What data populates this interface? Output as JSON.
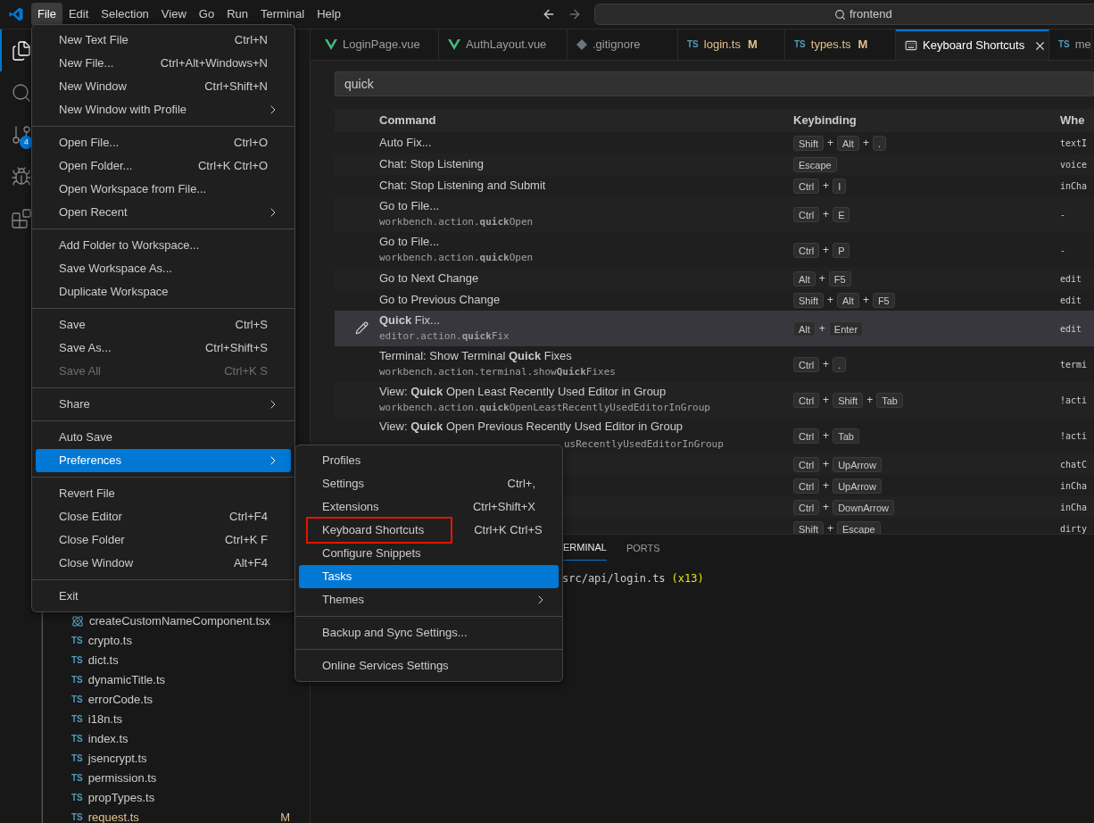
{
  "menu_bar": {
    "items": [
      {
        "label": "File",
        "selected": true
      },
      {
        "label": "Edit",
        "selected": false
      },
      {
        "label": "Selection",
        "selected": false
      },
      {
        "label": "View",
        "selected": false
      },
      {
        "label": "Go",
        "selected": false
      },
      {
        "label": "Run",
        "selected": false
      },
      {
        "label": "Terminal",
        "selected": false
      },
      {
        "label": "Help",
        "selected": false
      }
    ]
  },
  "command_center": {
    "value": "frontend"
  },
  "activity_bar": [
    {
      "kind": "explorer",
      "selected": true
    },
    {
      "kind": "search",
      "selected": false
    },
    {
      "kind": "scm",
      "selected": false,
      "badge": "4"
    },
    {
      "kind": "debug",
      "selected": false
    },
    {
      "kind": "extensions",
      "selected": false
    }
  ],
  "sidebar": {
    "files": [
      {
        "name": "createCustomNameComponent.tsx",
        "kind": "react"
      },
      {
        "name": "crypto.ts",
        "kind": "ts",
        "type_label": "TS"
      },
      {
        "name": "dict.ts",
        "kind": "ts",
        "type_label": "TS"
      },
      {
        "name": "dynamicTitle.ts",
        "kind": "ts",
        "type_label": "TS"
      },
      {
        "name": "errorCode.ts",
        "kind": "ts",
        "type_label": "TS"
      },
      {
        "name": "i18n.ts",
        "kind": "ts",
        "type_label": "TS"
      },
      {
        "name": "index.ts",
        "kind": "ts",
        "type_label": "TS"
      },
      {
        "name": "jsencrypt.ts",
        "kind": "ts",
        "type_label": "TS"
      },
      {
        "name": "permission.ts",
        "kind": "ts",
        "type_label": "TS"
      },
      {
        "name": "propTypes.ts",
        "kind": "ts",
        "type_label": "TS"
      },
      {
        "name": "request.ts",
        "kind": "ts",
        "type_label": "TS",
        "status": "M"
      }
    ]
  },
  "tabs": [
    {
      "label": "LoginPage.vue",
      "kind": "vue",
      "selected": false
    },
    {
      "label": "AuthLayout.vue",
      "kind": "vue",
      "selected": false
    },
    {
      "label": ".gitignore",
      "kind": "git",
      "selected": false
    },
    {
      "label": "login.ts",
      "kind": "ts",
      "type_label": "TS",
      "status": "M",
      "selected": false
    },
    {
      "label": "types.ts",
      "kind": "ts",
      "type_label": "TS",
      "status": "M",
      "selected": false
    },
    {
      "label": "Keyboard Shortcuts",
      "kind": "keyboard",
      "selected": true
    },
    {
      "label": "me",
      "kind": "ts",
      "type_label": "TS",
      "selected": false
    }
  ],
  "search": {
    "value": "quick"
  },
  "table": {
    "columns": [
      "Command",
      "Keybinding",
      "Whe"
    ],
    "key_separator": "+",
    "rows": [
      {
        "command": "Auto Fix...",
        "keys": [
          "Shift",
          "Alt",
          "."
        ],
        "when": "textI",
        "selected": false
      },
      {
        "command": "Chat: Stop Listening",
        "keys": [
          "Escape"
        ],
        "when": "voice",
        "selected": false
      },
      {
        "command": "Chat: Stop Listening and Submit",
        "keys": [
          "Ctrl",
          "I"
        ],
        "when": "inCha",
        "selected": false
      },
      {
        "command": "Go to File...",
        "command_id": "workbench.action.**quick**Open",
        "keys": [
          "Ctrl",
          "E"
        ],
        "when": "-",
        "selected": false
      },
      {
        "command": "Go to File...",
        "command_id": "workbench.action.**quick**Open",
        "keys": [
          "Ctrl",
          "P"
        ],
        "when": "-",
        "selected": false
      },
      {
        "command": "Go to Next Change",
        "keys": [
          "Alt",
          "F5"
        ],
        "when": "edit",
        "selected": false
      },
      {
        "command": "Go to Previous Change",
        "keys": [
          "Shift",
          "Alt",
          "F5"
        ],
        "when": "edit",
        "selected": false
      },
      {
        "command": "**Quick** Fix...",
        "command_id": "editor.action.**quick**Fix",
        "keys": [
          "Alt",
          "Enter"
        ],
        "when": "edit",
        "selected": true
      },
      {
        "command": "Terminal: Show Terminal **Quick** Fixes",
        "command_id": "workbench.action.terminal.show**Quick**Fixes",
        "keys": [
          "Ctrl",
          "."
        ],
        "when": "termi",
        "selected": false
      },
      {
        "command": "View: **Quick** Open Least Recently Used Editor in Group",
        "command_id": "workbench.action.**quick**OpenLeastRecentlyUsedEditorInGroup",
        "keys": [
          "Ctrl",
          "Shift",
          "Tab"
        ],
        "when": "!acti",
        "selected": false
      },
      {
        "command": "View: **Quick** Open Previous Recently Used Editor in Group",
        "command_id": "usRecentlyUsedEditorInGroup",
        "id_covered": true,
        "keys": [
          "Ctrl",
          "Tab"
        ],
        "when": "!acti",
        "selected": false
      },
      {
        "keys": [
          "Ctrl",
          "UpArrow"
        ],
        "when": "chatC",
        "selected": false
      },
      {
        "keys": [
          "Ctrl",
          "UpArrow"
        ],
        "when": "inCha",
        "selected": false
      },
      {
        "keys": [
          "Ctrl",
          "DownArrow"
        ],
        "when": "inCha",
        "selected": false
      },
      {
        "keys": [
          "Shift",
          "Escape"
        ],
        "when": "dirty",
        "selected": false
      }
    ]
  },
  "panel": {
    "tabs": [
      {
        "label": "ERMINAL",
        "selected": true
      },
      {
        "label": "PORTS",
        "selected": false
      }
    ],
    "terminal_lines": [
      {
        "text": "src/api/login.ts",
        "note": "(x13)"
      }
    ]
  },
  "file_menu": {
    "groups": [
      [
        {
          "label": "New Text File",
          "shortcut": "Ctrl+N"
        },
        {
          "label": "New File...",
          "shortcut": "Ctrl+Alt+Windows+N"
        },
        {
          "label": "New Window",
          "shortcut": "Ctrl+Shift+N"
        },
        {
          "label": "New Window with Profile",
          "submenu": true
        }
      ],
      [
        {
          "label": "Open File...",
          "shortcut": "Ctrl+O"
        },
        {
          "label": "Open Folder...",
          "shortcut": "Ctrl+K Ctrl+O"
        },
        {
          "label": "Open Workspace from File..."
        },
        {
          "label": "Open Recent",
          "submenu": true
        }
      ],
      [
        {
          "label": "Add Folder to Workspace..."
        },
        {
          "label": "Save Workspace As..."
        },
        {
          "label": "Duplicate Workspace"
        }
      ],
      [
        {
          "label": "Save",
          "shortcut": "Ctrl+S"
        },
        {
          "label": "Save As...",
          "shortcut": "Ctrl+Shift+S"
        },
        {
          "label": "Save All",
          "shortcut": "Ctrl+K S",
          "disabled": true
        }
      ],
      [
        {
          "label": "Share",
          "submenu": true
        }
      ],
      [
        {
          "label": "Auto Save"
        },
        {
          "label": "Preferences",
          "submenu": true,
          "selected": true
        }
      ],
      [
        {
          "label": "Revert File"
        },
        {
          "label": "Close Editor",
          "shortcut": "Ctrl+F4"
        },
        {
          "label": "Close Folder",
          "shortcut": "Ctrl+K F"
        },
        {
          "label": "Close Window",
          "shortcut": "Alt+F4"
        }
      ],
      [
        {
          "label": "Exit"
        }
      ]
    ]
  },
  "preferences_menu": {
    "groups": [
      [
        {
          "label": "Profiles"
        },
        {
          "label": "Settings",
          "shortcut": "Ctrl+,"
        },
        {
          "label": "Extensions",
          "shortcut": "Ctrl+Shift+X"
        },
        {
          "label": "Keyboard Shortcuts",
          "shortcut": "Ctrl+K Ctrl+S",
          "annotated": true
        },
        {
          "label": "Configure Snippets"
        },
        {
          "label": "Tasks",
          "selected": true
        },
        {
          "label": "Themes",
          "submenu": true
        }
      ],
      [
        {
          "label": "Backup and Sync Settings..."
        }
      ],
      [
        {
          "label": "Online Services Settings"
        }
      ]
    ]
  }
}
